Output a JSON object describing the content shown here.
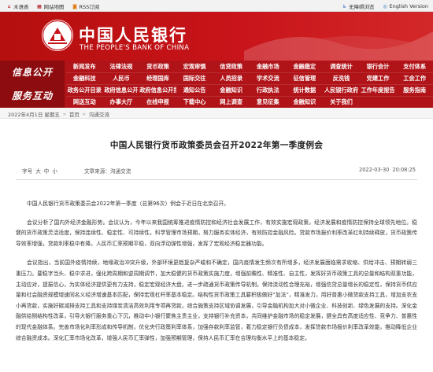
{
  "topbar": {
    "left": [
      {
        "label": "木语表",
        "icon": "home-icon"
      },
      {
        "label": "网站地图",
        "icon": "sitemap-icon"
      },
      {
        "label": "RSS订阅",
        "icon": "rss-icon"
      }
    ],
    "right": [
      {
        "label": "无障碍浏览",
        "icon": "accessibility-icon"
      },
      {
        "label": "English Version",
        "icon": "globe-icon"
      }
    ]
  },
  "banner": {
    "title_cn": "中国人民银行",
    "title_en": "THE PEOPLE'S BANK OF CHINA"
  },
  "nav": {
    "section1": "信息公开",
    "section2": "服务互动",
    "rows": [
      [
        "新闻发布",
        "法律法规",
        "货币政策",
        "宏观审慎",
        "信贷政策",
        "金融市场",
        "金融稳定",
        "调查统计",
        "银行会计",
        "支付体系"
      ],
      [
        "金融科技",
        "人民币",
        "经理国库",
        "国际交往",
        "人员招录",
        "学术交流",
        "征信管理",
        "反洗钱",
        "党建工作",
        "工会工作"
      ],
      [
        "政务公开目录",
        "政府信息公开",
        "政府信息公开指南",
        "通知公告",
        "金融知识",
        "行政执法",
        "统计数据",
        "人民银行政府",
        "工作年度报告",
        "服务指南"
      ],
      [
        "网送互动",
        "办事大厅",
        "在线申报",
        "下载中心",
        "网上调查",
        "意见征集",
        "金融知识",
        "关于我们",
        "",
        ""
      ]
    ]
  },
  "breadcrumb": {
    "date": "2022年4月1日 星期五",
    "home": "首页",
    "section": "沟通交流",
    "sep": "»"
  },
  "article": {
    "title": "中国人民银行货币政策委员会召开2022年第一季度例会",
    "font_size_label": "字号",
    "font_sizes": [
      "大",
      "中",
      "小"
    ],
    "source": "文章来源：沟通交流",
    "date": "2022-03-30",
    "time": "20:08:25",
    "paragraphs": [
      "中国人民银行货币政策委员会2022年第一季度（总第96次）例会于近日在北京召开。",
      "会议分析了国内外经济金融形势。会议认为，今年以来我国统筹推进疫情防控和经济社会发展工作，有效实施宏观政策，经济发展和疫情防控保持全球领先地位。稳健的货币政策灵活适度，保持连续性、稳定性、可持续性，科学管理市场预期，努力服务实体经济，有效防控金融风险。贷款市场报价利率改革红利持续释放，货币政策传导效率增强，贷款利率稳中有降，人民币汇率预期平稳，双向浮动弹性增强，发挥了宏观经济稳定器功能。",
      "会议指出，当前国外疫情持续，地缘政治冲突升级，外部环境更趋复杂严峻和不确定，国内疫情发生频次有所增多，经济发展面临需求收缩、供给冲击、预期转弱三重压力。要稳字当头、稳中求进，强化跨周期和逆周期调节，加大稳健的货币政策实施力度，增强前瞻性、精准性、自主性，发挥好货币政策工具的总量和结构双重功能，主动应对，提振信心，为实体经济提供更有力支持，稳定宏观经济大盘。进一步疏通货币政策传导机制，保持流动性合理充裕，增强信贷总量增长的稳定性，保持货币供应量和社会融资规模增速同名义经济增速基本匹配，保持宏观杠杆率基本稳定。结构性货币政策工具要积极做好“加法”，精准发力，用好普惠小微贷款支持工具，增加支农支小再贷款，实施好碳减排支持工具和支持煤炭清洁高效利用专项再贷款，综合施策支持区域协调发展，引导金融机构加大对小微企业、科技创新、绿色发展的支持。深化金融供给侧结构性改革，引导大银行服务重心下沉，推动中小银行聚焦主责主业，支持银行补充资本，共同维护金融市场的稳定发展，健全具有高度适应性、竞争力、普惠性的现代金融体系。完善市场化利率形成和传导机制，优化央行政策利率体系，加强存款利率监管，着力稳定银行负债成本，发挥贷款市场报价利率改革效能，推动降低企业综合融资成本。深化汇率市场化改革，增强人民币汇率弹性，加强预期管理，保持人民币汇率在合理均衡水平上的基本稳定。"
    ]
  }
}
